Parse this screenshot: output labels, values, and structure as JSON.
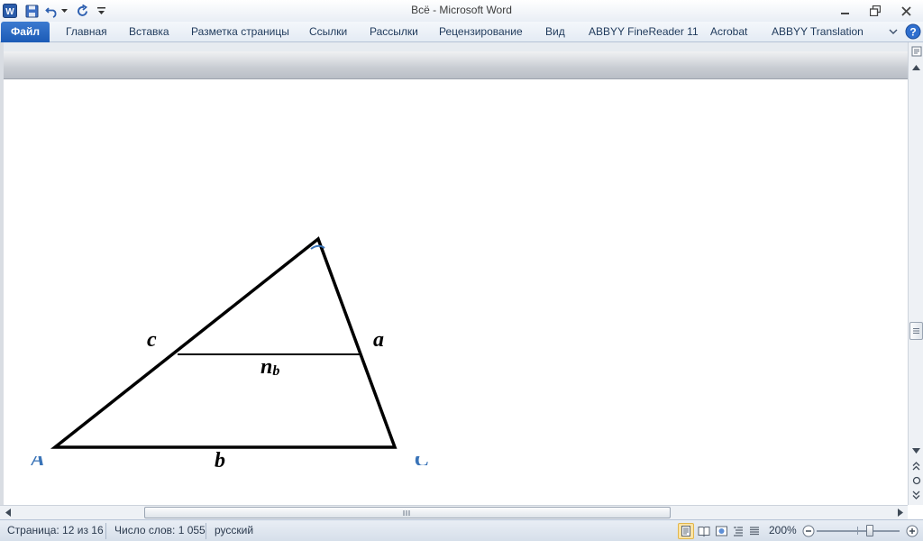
{
  "window": {
    "title": "Всё  -  Microsoft Word"
  },
  "ribbon": {
    "tabs": [
      {
        "label": "Файл"
      },
      {
        "label": "Главная"
      },
      {
        "label": "Вставка"
      },
      {
        "label": "Разметка страницы"
      },
      {
        "label": "Ссылки"
      },
      {
        "label": "Рассылки"
      },
      {
        "label": "Рецензирование"
      },
      {
        "label": "Вид"
      },
      {
        "label": "ABBYY FineReader 11"
      },
      {
        "label": "Acrobat"
      },
      {
        "label": "ABBYY Translation"
      }
    ]
  },
  "document": {
    "labels": {
      "side_c": "c",
      "side_a": "a",
      "side_b": "b",
      "segment_main": "n",
      "segment_sub": "b",
      "vertex_partial_left": "A",
      "vertex_partial_right": "C"
    }
  },
  "status": {
    "page": "Страница: 12 из 16",
    "words": "Число слов: 1 055",
    "language": "русский",
    "zoom": "200%"
  },
  "colors": {
    "file_tab": "#1c5bb6",
    "ribbon_text": "#1e395b",
    "label_blue": "#3a74b8"
  },
  "icons": [
    "word-app-icon",
    "save-icon",
    "undo-icon",
    "redo-icon",
    "customize-toolbar-icon",
    "minimize-icon",
    "restore-icon",
    "close-icon",
    "ribbon-collapse-icon",
    "help-icon",
    "ruler-toggle-icon",
    "scroll-up-icon",
    "scroll-down-icon",
    "prev-page-icon",
    "select-browse-icon",
    "next-page-icon",
    "scroll-left-icon",
    "scroll-right-icon",
    "zoom-out-icon",
    "zoom-in-icon"
  ]
}
